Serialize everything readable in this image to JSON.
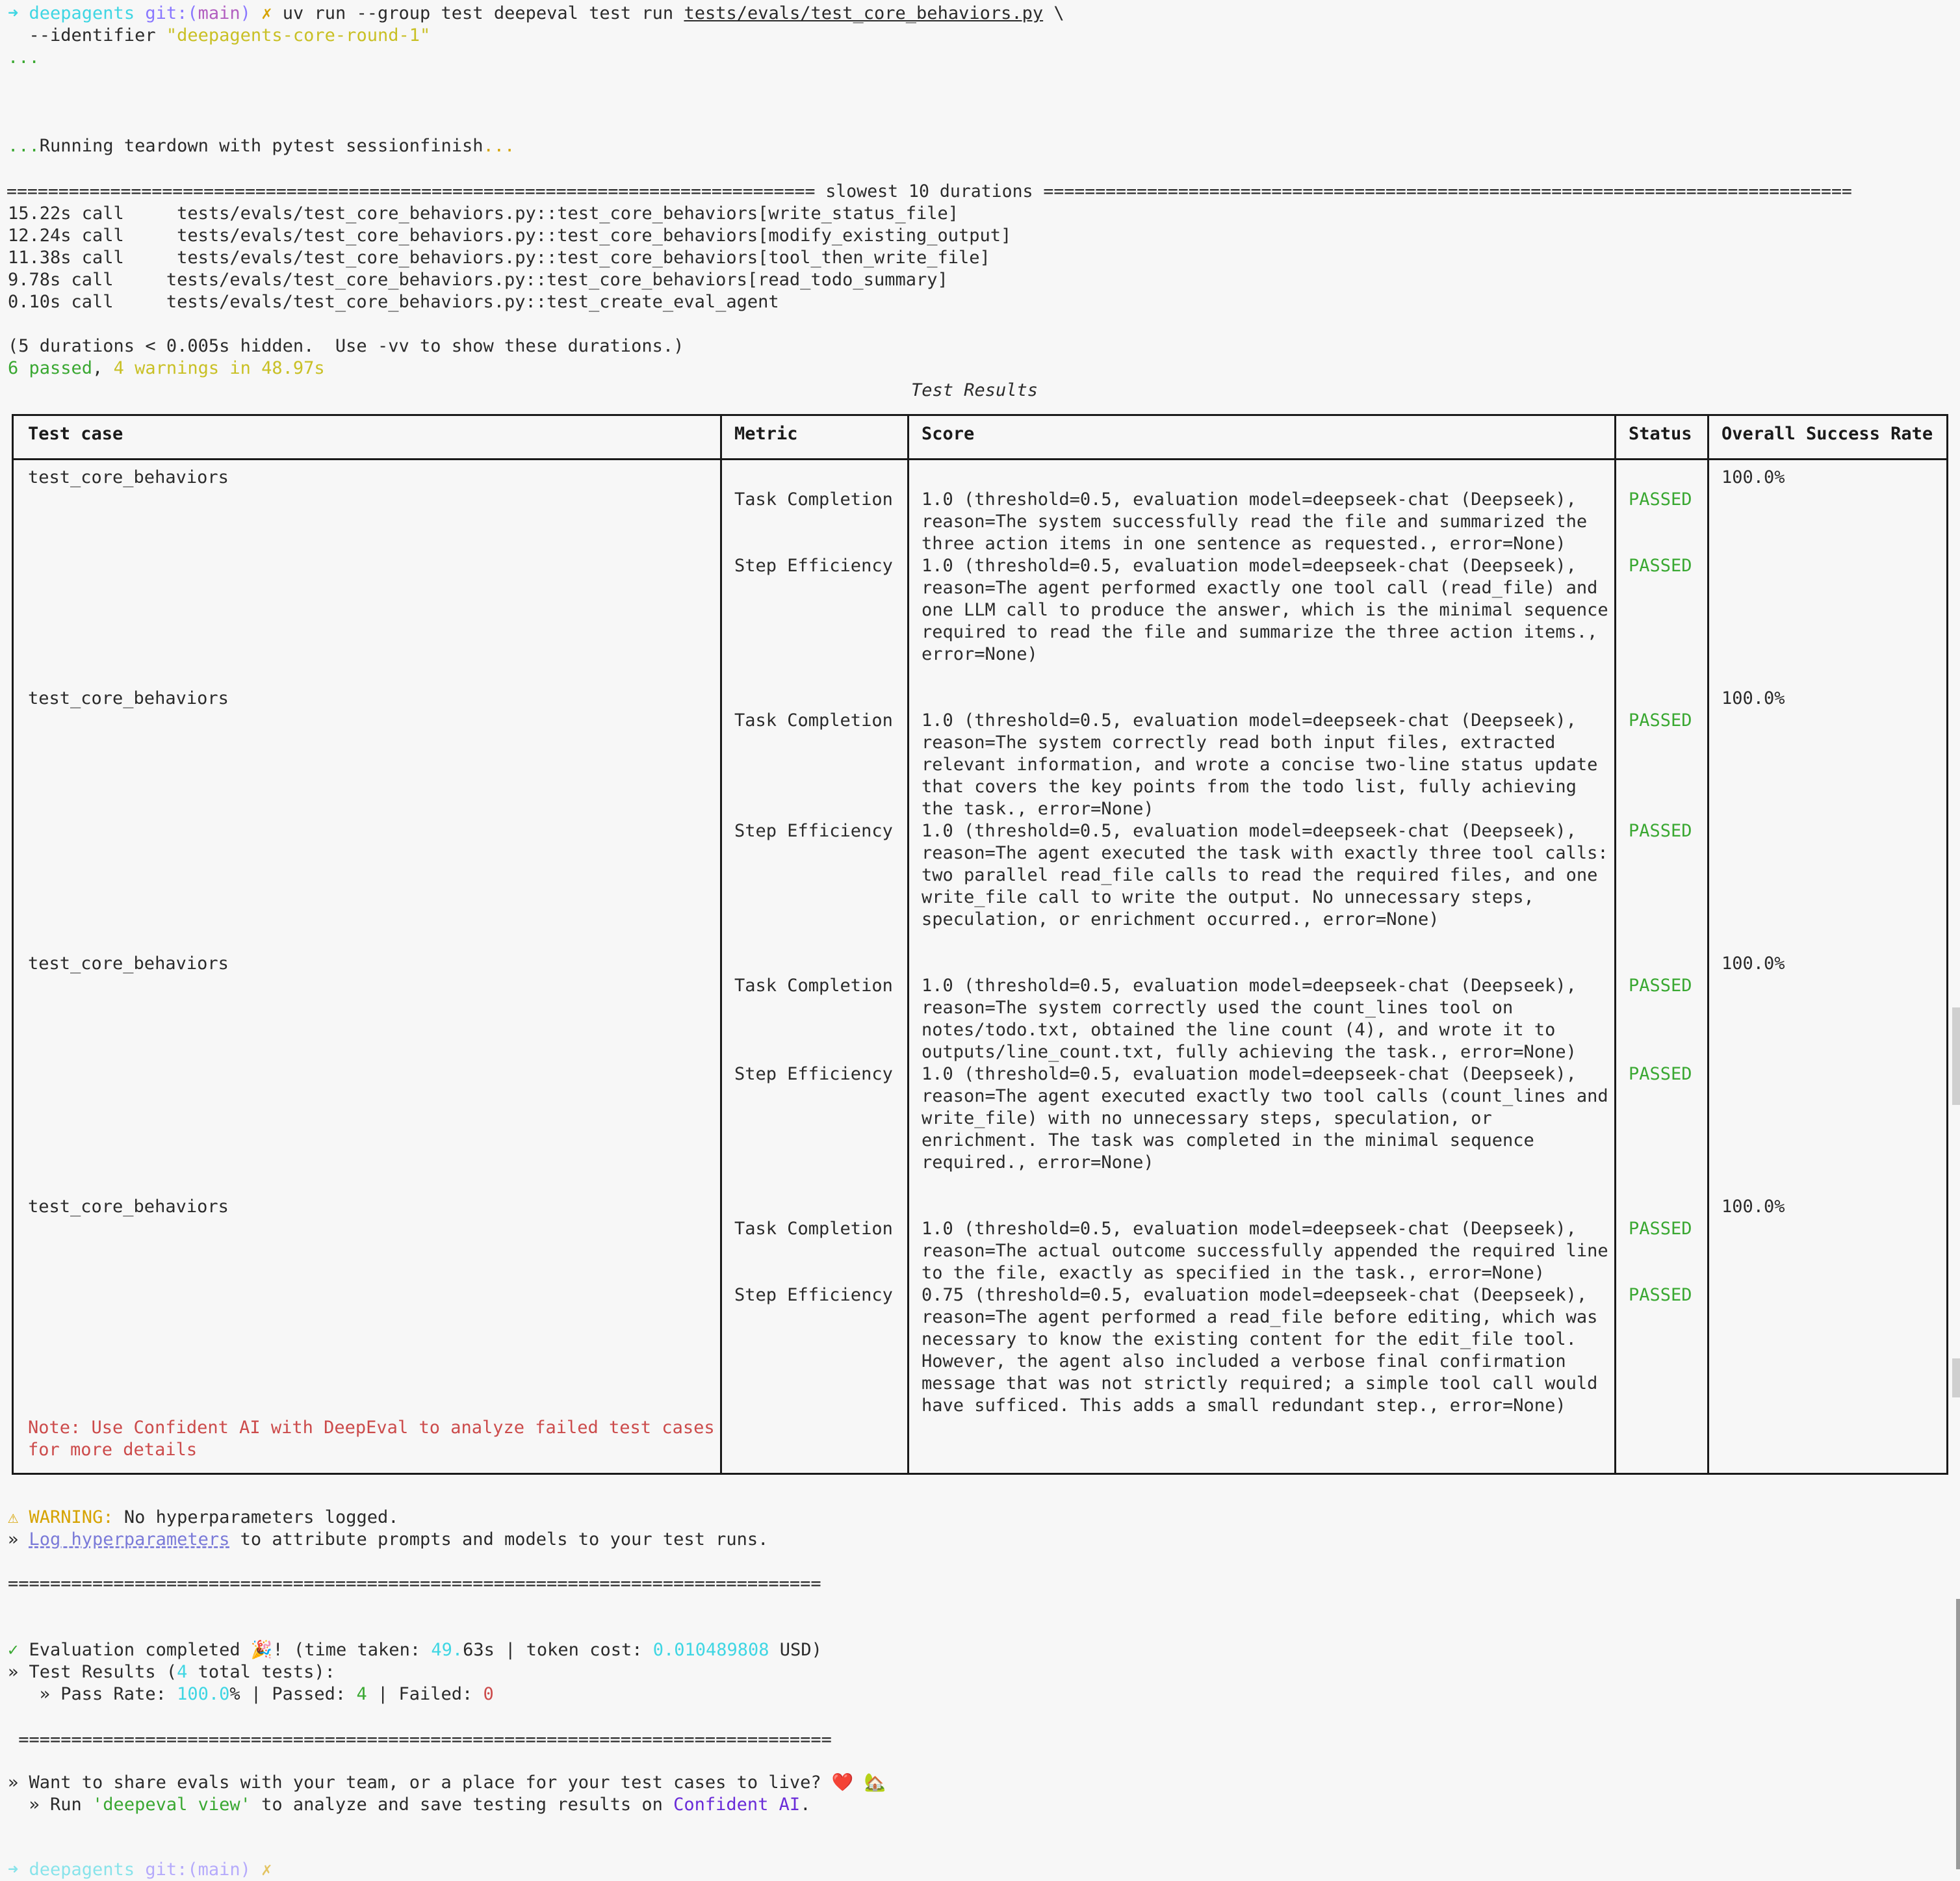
{
  "prompt": {
    "dir": "deepagents",
    "git_prefix": "git:(",
    "branch": "main",
    "git_suffix": ")",
    "dirty_mark": "✗",
    "command": "uv run --group test deepeval test run",
    "command_path": "tests/evals/test_core_behaviors.py",
    "cont": " \\",
    "line2_prefix": "  --identifier",
    "identifier": "\"deepagents-core-round-1\""
  },
  "dots1": "...",
  "teardown": {
    "pre": "...",
    "text": "Running teardown with pytest sessionfinish",
    "post": "..."
  },
  "durations": {
    "header": "============================================================================== slowest 10 durations ==============================================================================",
    "items": [
      "15.22s call     tests/evals/test_core_behaviors.py::test_core_behaviors[write_status_file]",
      "12.24s call     tests/evals/test_core_behaviors.py::test_core_behaviors[modify_existing_output]",
      "11.38s call     tests/evals/test_core_behaviors.py::test_core_behaviors[tool_then_write_file]",
      "9.78s call     tests/evals/test_core_behaviors.py::test_core_behaviors[read_todo_summary]",
      "0.10s call     tests/evals/test_core_behaviors.py::test_create_eval_agent"
    ],
    "hidden_note": "(5 durations < 0.005s hidden.  Use -vv to show these durations.)"
  },
  "summary": {
    "passed": "6 passed",
    "sep": ", ",
    "warnings": "4 warnings in 48.97s"
  },
  "table": {
    "title": "Test Results",
    "headers": {
      "test_case": "Test case",
      "metric": "Metric",
      "score": "Score",
      "status": "Status",
      "rate": "Overall Success Rate"
    },
    "rows": [
      {
        "name": "test_core_behaviors",
        "rate": "100.0%",
        "m1": "Task Completion",
        "s1": "1.0 (threshold=0.5, evaluation model=deepseek-chat (Deepseek),\nreason=The system successfully read the file and summarized the\nthree action items in one sentence as requested., error=None)",
        "st1": "PASSED",
        "m2": "Step Efficiency",
        "s2": "1.0 (threshold=0.5, evaluation model=deepseek-chat (Deepseek),\nreason=The agent performed exactly one tool call (read_file) and\none LLM call to produce the answer, which is the minimal sequence\nrequired to read the file and summarize the three action items.,\nerror=None)",
        "st2": "PASSED"
      },
      {
        "name": "test_core_behaviors",
        "rate": "100.0%",
        "m1": "Task Completion",
        "s1": "1.0 (threshold=0.5, evaluation model=deepseek-chat (Deepseek),\nreason=The system correctly read both input files, extracted\nrelevant information, and wrote a concise two-line status update\nthat covers the key points from the todo list, fully achieving\nthe task., error=None)",
        "st1": "PASSED",
        "m2": "Step Efficiency",
        "s2": "1.0 (threshold=0.5, evaluation model=deepseek-chat (Deepseek),\nreason=The agent executed the task with exactly three tool calls:\ntwo parallel read_file calls to read the required files, and one\nwrite_file call to write the output. No unnecessary steps,\nspeculation, or enrichment occurred., error=None)",
        "st2": "PASSED"
      },
      {
        "name": "test_core_behaviors",
        "rate": "100.0%",
        "m1": "Task Completion",
        "s1": "1.0 (threshold=0.5, evaluation model=deepseek-chat (Deepseek),\nreason=The system correctly used the count_lines tool on\nnotes/todo.txt, obtained the line count (4), and wrote it to\noutputs/line_count.txt, fully achieving the task., error=None)",
        "st1": "PASSED",
        "m2": "Step Efficiency",
        "s2": "1.0 (threshold=0.5, evaluation model=deepseek-chat (Deepseek),\nreason=The agent executed exactly two tool calls (count_lines and\nwrite_file) with no unnecessary steps, speculation, or\nenrichment. The task was completed in the minimal sequence\nrequired., error=None)",
        "st2": "PASSED"
      },
      {
        "name": "test_core_behaviors",
        "rate": "100.0%",
        "m1": "Task Completion",
        "s1": "1.0 (threshold=0.5, evaluation model=deepseek-chat (Deepseek),\nreason=The actual outcome successfully appended the required line\nto the file, exactly as specified in the task., error=None)",
        "st1": "PASSED",
        "m2": "Step Efficiency",
        "s2": "0.75 (threshold=0.5, evaluation model=deepseek-chat (Deepseek),\nreason=The agent performed a read_file before editing, which was\nnecessary to know the existing content for the edit_file tool.\nHowever, the agent also included a verbose final confirmation\nmessage that was not strictly required; a simple tool call would\nhave sufficed. This adds a small redundant step., error=None)",
        "st2": "PASSED"
      }
    ],
    "note": "Note: Use Confident AI with DeepEval to analyze failed test cases\nfor more details"
  },
  "warning": {
    "icon": "⚠",
    "label": "WARNING:",
    "text": " No hyperparameters logged."
  },
  "hyper": {
    "prefix": "» ",
    "link": "Log hyperparameters",
    "text": " to attribute prompts and models to your test runs."
  },
  "sep1": "=============================================================================",
  "completed": {
    "check": "✓",
    "pre": " Evaluation completed 🎉! (time taken: ",
    "time_num": "49.",
    "time_rest": "63s | token cost: ",
    "cost": "0.010489808",
    "post": " USD)"
  },
  "results_line": {
    "pre": "» Test Results (",
    "num": "4",
    "post": " total tests):"
  },
  "pass_rate": {
    "pre": "   » Pass Rate: ",
    "rate": "100.0",
    "mid": "% | Passed: ",
    "passed": "4",
    "mid2": " | Failed: ",
    "failed": "0"
  },
  "sep2": " =============================================================================",
  "share": {
    "text": "» Want to share evals with your team, or a place for your test cases to live? ❤️ 🏡"
  },
  "run": {
    "pre": "  » Run ",
    "cmd": "'deepeval view'",
    "mid": " to analyze and save testing results on ",
    "link": "Confident AI",
    "post": "."
  },
  "final_prompt": {
    "dir": "deepagents",
    "git": "git:(main)",
    "mark": "✗"
  }
}
